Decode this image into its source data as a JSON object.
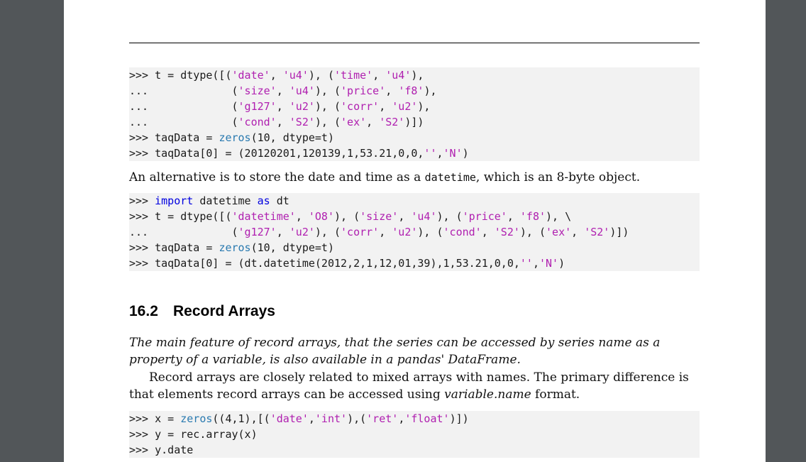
{
  "code_block_1": [
    [
      {
        "t": "p",
        "v": ">>> t = dtype([("
      },
      {
        "t": "s",
        "v": "'date'"
      },
      {
        "t": "p",
        "v": ", "
      },
      {
        "t": "s",
        "v": "'u4'"
      },
      {
        "t": "p",
        "v": "), ("
      },
      {
        "t": "s",
        "v": "'time'"
      },
      {
        "t": "p",
        "v": ", "
      },
      {
        "t": "s",
        "v": "'u4'"
      },
      {
        "t": "p",
        "v": "),"
      }
    ],
    [
      {
        "t": "p",
        "v": "...             ("
      },
      {
        "t": "s",
        "v": "'size'"
      },
      {
        "t": "p",
        "v": ", "
      },
      {
        "t": "s",
        "v": "'u4'"
      },
      {
        "t": "p",
        "v": "), ("
      },
      {
        "t": "s",
        "v": "'price'"
      },
      {
        "t": "p",
        "v": ", "
      },
      {
        "t": "s",
        "v": "'f8'"
      },
      {
        "t": "p",
        "v": "),"
      }
    ],
    [
      {
        "t": "p",
        "v": "...             ("
      },
      {
        "t": "s",
        "v": "'g127'"
      },
      {
        "t": "p",
        "v": ", "
      },
      {
        "t": "s",
        "v": "'u2'"
      },
      {
        "t": "p",
        "v": "), ("
      },
      {
        "t": "s",
        "v": "'corr'"
      },
      {
        "t": "p",
        "v": ", "
      },
      {
        "t": "s",
        "v": "'u2'"
      },
      {
        "t": "p",
        "v": "),"
      }
    ],
    [
      {
        "t": "p",
        "v": "...             ("
      },
      {
        "t": "s",
        "v": "'cond'"
      },
      {
        "t": "p",
        "v": ", "
      },
      {
        "t": "s",
        "v": "'S2'"
      },
      {
        "t": "p",
        "v": "), ("
      },
      {
        "t": "s",
        "v": "'ex'"
      },
      {
        "t": "p",
        "v": ", "
      },
      {
        "t": "s",
        "v": "'S2'"
      },
      {
        "t": "p",
        "v": ")])"
      }
    ],
    [
      {
        "t": "p",
        "v": ">>> taqData = "
      },
      {
        "t": "f",
        "v": "zeros"
      },
      {
        "t": "p",
        "v": "(10, dtype=t)"
      }
    ],
    [
      {
        "t": "p",
        "v": ">>> taqData[0] = (20120201,120139,1,53.21,0,0,"
      },
      {
        "t": "s",
        "v": "''"
      },
      {
        "t": "p",
        "v": ","
      },
      {
        "t": "s",
        "v": "'N'"
      },
      {
        "t": "p",
        "v": ")"
      }
    ]
  ],
  "para_1": {
    "before": "An alternative is to store the date and time as a ",
    "code": "datetime",
    "after": ", which is an 8-byte object."
  },
  "code_block_2": [
    [
      {
        "t": "p",
        "v": ">>> "
      },
      {
        "t": "k",
        "v": "import"
      },
      {
        "t": "p",
        "v": " datetime "
      },
      {
        "t": "k",
        "v": "as"
      },
      {
        "t": "p",
        "v": " dt"
      }
    ],
    [
      {
        "t": "p",
        "v": ">>> t = dtype([("
      },
      {
        "t": "s",
        "v": "'datetime'"
      },
      {
        "t": "p",
        "v": ", "
      },
      {
        "t": "s",
        "v": "'O8'"
      },
      {
        "t": "p",
        "v": "), ("
      },
      {
        "t": "s",
        "v": "'size'"
      },
      {
        "t": "p",
        "v": ", "
      },
      {
        "t": "s",
        "v": "'u4'"
      },
      {
        "t": "p",
        "v": "), ("
      },
      {
        "t": "s",
        "v": "'price'"
      },
      {
        "t": "p",
        "v": ", "
      },
      {
        "t": "s",
        "v": "'f8'"
      },
      {
        "t": "p",
        "v": "), \\"
      }
    ],
    [
      {
        "t": "p",
        "v": "...             ("
      },
      {
        "t": "s",
        "v": "'g127'"
      },
      {
        "t": "p",
        "v": ", "
      },
      {
        "t": "s",
        "v": "'u2'"
      },
      {
        "t": "p",
        "v": "), ("
      },
      {
        "t": "s",
        "v": "'corr'"
      },
      {
        "t": "p",
        "v": ", "
      },
      {
        "t": "s",
        "v": "'u2'"
      },
      {
        "t": "p",
        "v": "), ("
      },
      {
        "t": "s",
        "v": "'cond'"
      },
      {
        "t": "p",
        "v": ", "
      },
      {
        "t": "s",
        "v": "'S2'"
      },
      {
        "t": "p",
        "v": "), ("
      },
      {
        "t": "s",
        "v": "'ex'"
      },
      {
        "t": "p",
        "v": ", "
      },
      {
        "t": "s",
        "v": "'S2'"
      },
      {
        "t": "p",
        "v": ")])"
      }
    ],
    [
      {
        "t": "p",
        "v": ">>> taqData = "
      },
      {
        "t": "f",
        "v": "zeros"
      },
      {
        "t": "p",
        "v": "(10, dtype=t)"
      }
    ],
    [
      {
        "t": "p",
        "v": ">>> taqData[0] = (dt.datetime(2012,2,1,12,01,39),1,53.21,0,0,"
      },
      {
        "t": "s",
        "v": "''"
      },
      {
        "t": "p",
        "v": ","
      },
      {
        "t": "s",
        "v": "'N'"
      },
      {
        "t": "p",
        "v": ")"
      }
    ]
  ],
  "section": {
    "number": "16.2",
    "title": "Record Arrays"
  },
  "para_2": "The main feature of record arrays, that the series can be accessed by series name as a property of a variable, is also available in a pandas' DataFrame.",
  "para_3": {
    "before": "Record arrays are closely related to mixed arrays with names. The primary difference is that elements record arrays can be accessed using ",
    "italic": "variable.name",
    "after": " format."
  },
  "code_block_3": [
    [
      {
        "t": "p",
        "v": ">>> x = "
      },
      {
        "t": "f",
        "v": "zeros"
      },
      {
        "t": "p",
        "v": "((4,1),[("
      },
      {
        "t": "s",
        "v": "'date'"
      },
      {
        "t": "p",
        "v": ","
      },
      {
        "t": "s",
        "v": "'int'"
      },
      {
        "t": "p",
        "v": "),("
      },
      {
        "t": "s",
        "v": "'ret'"
      },
      {
        "t": "p",
        "v": ","
      },
      {
        "t": "s",
        "v": "'float'"
      },
      {
        "t": "p",
        "v": ")])"
      }
    ],
    [
      {
        "t": "p",
        "v": ">>> y = rec.array(x)"
      }
    ],
    [
      {
        "t": "p",
        "v": ">>> y.date"
      }
    ]
  ],
  "colors": {
    "keyword": "#0000e0",
    "function": "#2a7ab0",
    "string": "#b020b0",
    "code_bg": "#f2f2f2",
    "viewer_bg": "#525659"
  }
}
